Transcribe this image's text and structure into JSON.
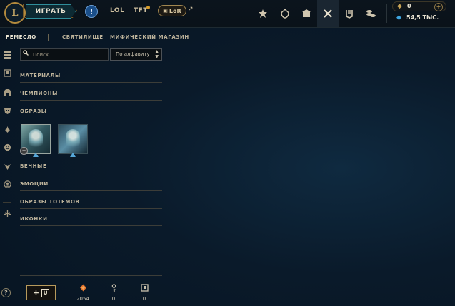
{
  "header": {
    "logo": "L",
    "play_label": "ИГРАТЬ",
    "alert_glyph": "!",
    "games": [
      "LOL",
      "TFT"
    ],
    "lor_label": "LoR",
    "lor_arrow": "↗",
    "nav_icons": [
      "clash-icon",
      "tft-hub-icon",
      "profile-icon",
      "loot-icon",
      "collection-icon",
      "store-icon"
    ],
    "rp": {
      "icon": "rp-icon",
      "value": "0",
      "plus": "+"
    },
    "be": {
      "icon": "blue-essence-icon",
      "value": "54,5 ТЫС."
    }
  },
  "subnav": {
    "tabs": [
      "РЕМЕСЛО",
      "СВЯТИЛИЩЕ",
      "МИФИЧЕСКИЙ МАГАЗИН"
    ],
    "active": "РЕМЕСЛО"
  },
  "rail": {
    "icons": [
      "grid-icon",
      "chest-icon",
      "helmet-icon",
      "mask-icon",
      "ward-icon",
      "emote-icon",
      "totem-icon",
      "profile-circle-icon",
      "eternals-icon"
    ],
    "help": "?"
  },
  "filters": {
    "search_placeholder": "Поиск",
    "sort_label": "По алфавиту"
  },
  "categories": {
    "materials": "МАТЕРИАЛЫ",
    "champions": "ЧЕМПИОНЫ",
    "skins": "ОБРАЗЫ",
    "eternals": "ВЕЧНЫЕ",
    "emotes": "ЭМОЦИИ",
    "ward_skins": "ОБРАЗЫ ТОТЕМОВ",
    "icons": "ИКОНКИ"
  },
  "skins": [
    {
      "name": "skin-1",
      "rarity": "epic"
    },
    {
      "name": "skin-2",
      "rarity": "epic"
    }
  ],
  "footer": {
    "add_label": "+",
    "stats": [
      {
        "icon": "orange-essence-icon",
        "value": "2054",
        "color": "#e0702a"
      },
      {
        "icon": "key-icon",
        "value": "0",
        "color": "#c9c1ad"
      },
      {
        "icon": "chest-icon",
        "value": "0",
        "color": "#c9c1ad"
      }
    ]
  }
}
